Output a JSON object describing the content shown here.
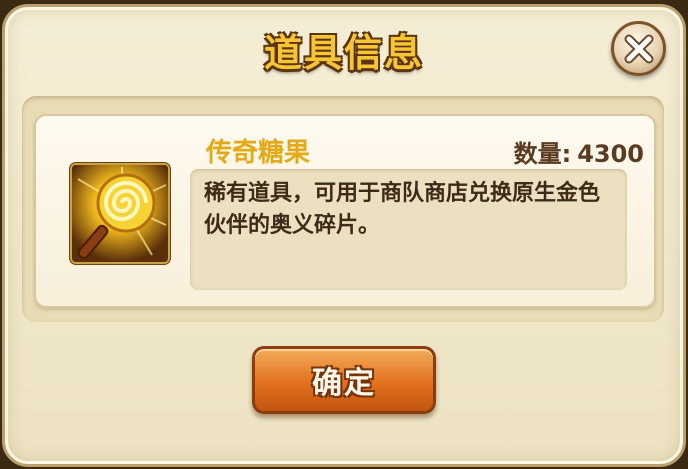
{
  "dialog": {
    "title": "道具信息",
    "close_icon": "close-x-icon"
  },
  "item": {
    "name": "传奇糖果",
    "quantity_label": "数量:",
    "quantity_value": "4300",
    "description": "稀有道具，可用于商队商店兑换原生金色伙伴的奥义碎片。",
    "icon": "lollipop-candy-icon"
  },
  "buttons": {
    "confirm_label": "确定"
  },
  "colors": {
    "title_gold": "#f7c534",
    "item_name_gold": "#e2a91c",
    "confirm_orange": "#e2711f",
    "panel_bg": "#f5eed6"
  }
}
